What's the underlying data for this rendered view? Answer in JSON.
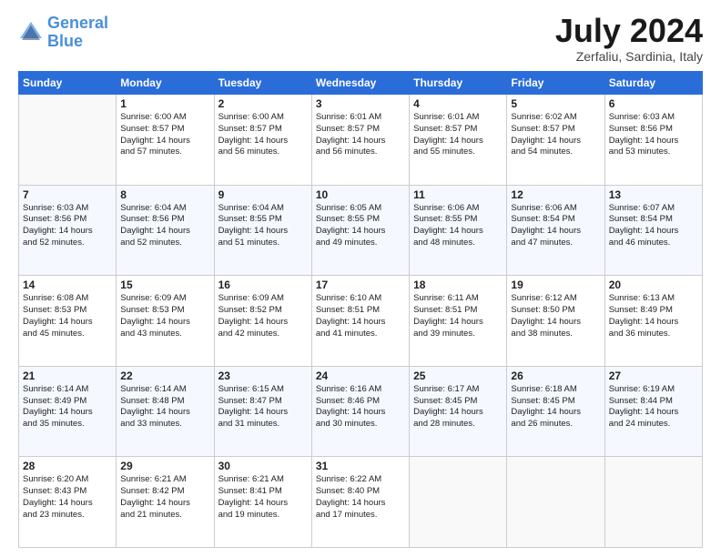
{
  "header": {
    "logo_line1": "General",
    "logo_line2": "Blue",
    "month_title": "July 2024",
    "location": "Zerfaliu, Sardinia, Italy"
  },
  "days_of_week": [
    "Sunday",
    "Monday",
    "Tuesday",
    "Wednesday",
    "Thursday",
    "Friday",
    "Saturday"
  ],
  "weeks": [
    [
      {
        "day": "",
        "sunrise": "",
        "sunset": "",
        "daylight": ""
      },
      {
        "day": "1",
        "sunrise": "Sunrise: 6:00 AM",
        "sunset": "Sunset: 8:57 PM",
        "daylight": "Daylight: 14 hours and 57 minutes."
      },
      {
        "day": "2",
        "sunrise": "Sunrise: 6:00 AM",
        "sunset": "Sunset: 8:57 PM",
        "daylight": "Daylight: 14 hours and 56 minutes."
      },
      {
        "day": "3",
        "sunrise": "Sunrise: 6:01 AM",
        "sunset": "Sunset: 8:57 PM",
        "daylight": "Daylight: 14 hours and 56 minutes."
      },
      {
        "day": "4",
        "sunrise": "Sunrise: 6:01 AM",
        "sunset": "Sunset: 8:57 PM",
        "daylight": "Daylight: 14 hours and 55 minutes."
      },
      {
        "day": "5",
        "sunrise": "Sunrise: 6:02 AM",
        "sunset": "Sunset: 8:57 PM",
        "daylight": "Daylight: 14 hours and 54 minutes."
      },
      {
        "day": "6",
        "sunrise": "Sunrise: 6:03 AM",
        "sunset": "Sunset: 8:56 PM",
        "daylight": "Daylight: 14 hours and 53 minutes."
      }
    ],
    [
      {
        "day": "7",
        "sunrise": "Sunrise: 6:03 AM",
        "sunset": "Sunset: 8:56 PM",
        "daylight": "Daylight: 14 hours and 52 minutes."
      },
      {
        "day": "8",
        "sunrise": "Sunrise: 6:04 AM",
        "sunset": "Sunset: 8:56 PM",
        "daylight": "Daylight: 14 hours and 52 minutes."
      },
      {
        "day": "9",
        "sunrise": "Sunrise: 6:04 AM",
        "sunset": "Sunset: 8:55 PM",
        "daylight": "Daylight: 14 hours and 51 minutes."
      },
      {
        "day": "10",
        "sunrise": "Sunrise: 6:05 AM",
        "sunset": "Sunset: 8:55 PM",
        "daylight": "Daylight: 14 hours and 49 minutes."
      },
      {
        "day": "11",
        "sunrise": "Sunrise: 6:06 AM",
        "sunset": "Sunset: 8:55 PM",
        "daylight": "Daylight: 14 hours and 48 minutes."
      },
      {
        "day": "12",
        "sunrise": "Sunrise: 6:06 AM",
        "sunset": "Sunset: 8:54 PM",
        "daylight": "Daylight: 14 hours and 47 minutes."
      },
      {
        "day": "13",
        "sunrise": "Sunrise: 6:07 AM",
        "sunset": "Sunset: 8:54 PM",
        "daylight": "Daylight: 14 hours and 46 minutes."
      }
    ],
    [
      {
        "day": "14",
        "sunrise": "Sunrise: 6:08 AM",
        "sunset": "Sunset: 8:53 PM",
        "daylight": "Daylight: 14 hours and 45 minutes."
      },
      {
        "day": "15",
        "sunrise": "Sunrise: 6:09 AM",
        "sunset": "Sunset: 8:53 PM",
        "daylight": "Daylight: 14 hours and 43 minutes."
      },
      {
        "day": "16",
        "sunrise": "Sunrise: 6:09 AM",
        "sunset": "Sunset: 8:52 PM",
        "daylight": "Daylight: 14 hours and 42 minutes."
      },
      {
        "day": "17",
        "sunrise": "Sunrise: 6:10 AM",
        "sunset": "Sunset: 8:51 PM",
        "daylight": "Daylight: 14 hours and 41 minutes."
      },
      {
        "day": "18",
        "sunrise": "Sunrise: 6:11 AM",
        "sunset": "Sunset: 8:51 PM",
        "daylight": "Daylight: 14 hours and 39 minutes."
      },
      {
        "day": "19",
        "sunrise": "Sunrise: 6:12 AM",
        "sunset": "Sunset: 8:50 PM",
        "daylight": "Daylight: 14 hours and 38 minutes."
      },
      {
        "day": "20",
        "sunrise": "Sunrise: 6:13 AM",
        "sunset": "Sunset: 8:49 PM",
        "daylight": "Daylight: 14 hours and 36 minutes."
      }
    ],
    [
      {
        "day": "21",
        "sunrise": "Sunrise: 6:14 AM",
        "sunset": "Sunset: 8:49 PM",
        "daylight": "Daylight: 14 hours and 35 minutes."
      },
      {
        "day": "22",
        "sunrise": "Sunrise: 6:14 AM",
        "sunset": "Sunset: 8:48 PM",
        "daylight": "Daylight: 14 hours and 33 minutes."
      },
      {
        "day": "23",
        "sunrise": "Sunrise: 6:15 AM",
        "sunset": "Sunset: 8:47 PM",
        "daylight": "Daylight: 14 hours and 31 minutes."
      },
      {
        "day": "24",
        "sunrise": "Sunrise: 6:16 AM",
        "sunset": "Sunset: 8:46 PM",
        "daylight": "Daylight: 14 hours and 30 minutes."
      },
      {
        "day": "25",
        "sunrise": "Sunrise: 6:17 AM",
        "sunset": "Sunset: 8:45 PM",
        "daylight": "Daylight: 14 hours and 28 minutes."
      },
      {
        "day": "26",
        "sunrise": "Sunrise: 6:18 AM",
        "sunset": "Sunset: 8:45 PM",
        "daylight": "Daylight: 14 hours and 26 minutes."
      },
      {
        "day": "27",
        "sunrise": "Sunrise: 6:19 AM",
        "sunset": "Sunset: 8:44 PM",
        "daylight": "Daylight: 14 hours and 24 minutes."
      }
    ],
    [
      {
        "day": "28",
        "sunrise": "Sunrise: 6:20 AM",
        "sunset": "Sunset: 8:43 PM",
        "daylight": "Daylight: 14 hours and 23 minutes."
      },
      {
        "day": "29",
        "sunrise": "Sunrise: 6:21 AM",
        "sunset": "Sunset: 8:42 PM",
        "daylight": "Daylight: 14 hours and 21 minutes."
      },
      {
        "day": "30",
        "sunrise": "Sunrise: 6:21 AM",
        "sunset": "Sunset: 8:41 PM",
        "daylight": "Daylight: 14 hours and 19 minutes."
      },
      {
        "day": "31",
        "sunrise": "Sunrise: 6:22 AM",
        "sunset": "Sunset: 8:40 PM",
        "daylight": "Daylight: 14 hours and 17 minutes."
      },
      {
        "day": "",
        "sunrise": "",
        "sunset": "",
        "daylight": ""
      },
      {
        "day": "",
        "sunrise": "",
        "sunset": "",
        "daylight": ""
      },
      {
        "day": "",
        "sunrise": "",
        "sunset": "",
        "daylight": ""
      }
    ]
  ]
}
